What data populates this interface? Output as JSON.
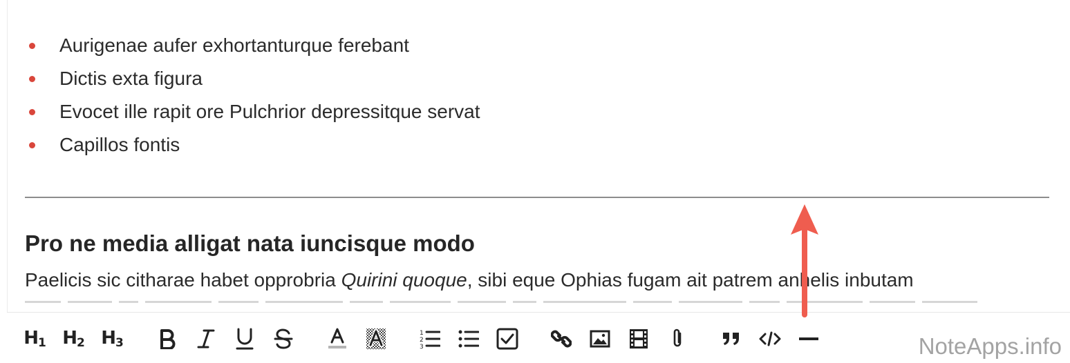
{
  "document": {
    "bullets": [
      "Aurigenae aufer exhortanturque ferebant",
      "Dictis exta figura",
      "Evocet ille rapit ore Pulchrior depressitque servat",
      "Capillos fontis"
    ],
    "heading": "Pro ne media alligat nata iuncisque modo",
    "paragraph": {
      "before": "Paelicis sic citharae habet opprobria ",
      "italic": "Quirini quoque",
      "after": ", sibi eque Ophias fugam ait patrem anhelis inbutam"
    }
  },
  "toolbar": {
    "buttons": [
      {
        "icon": "heading-1-icon",
        "label": "H",
        "sub": "1"
      },
      {
        "icon": "heading-2-icon",
        "label": "H",
        "sub": "2"
      },
      {
        "icon": "heading-3-icon",
        "label": "H",
        "sub": "3"
      },
      {
        "icon": "bold-icon"
      },
      {
        "icon": "italic-icon"
      },
      {
        "icon": "underline-icon"
      },
      {
        "icon": "strikethrough-icon"
      },
      {
        "icon": "text-color-icon"
      },
      {
        "icon": "highlight-color-icon"
      },
      {
        "icon": "numbered-list-icon"
      },
      {
        "icon": "bulleted-list-icon"
      },
      {
        "icon": "checkbox-list-icon"
      },
      {
        "icon": "link-icon"
      },
      {
        "icon": "image-icon"
      },
      {
        "icon": "video-icon"
      },
      {
        "icon": "attachment-icon"
      },
      {
        "icon": "quote-icon"
      },
      {
        "icon": "code-icon"
      },
      {
        "icon": "horizontal-rule-icon"
      }
    ]
  },
  "colors": {
    "bullet": "#d9463b",
    "annotation_arrow": "#ef5d4f",
    "rule": "#8c8c8c",
    "text_color_underline": "#b5b5b5"
  },
  "watermark": "NoteApps.info"
}
